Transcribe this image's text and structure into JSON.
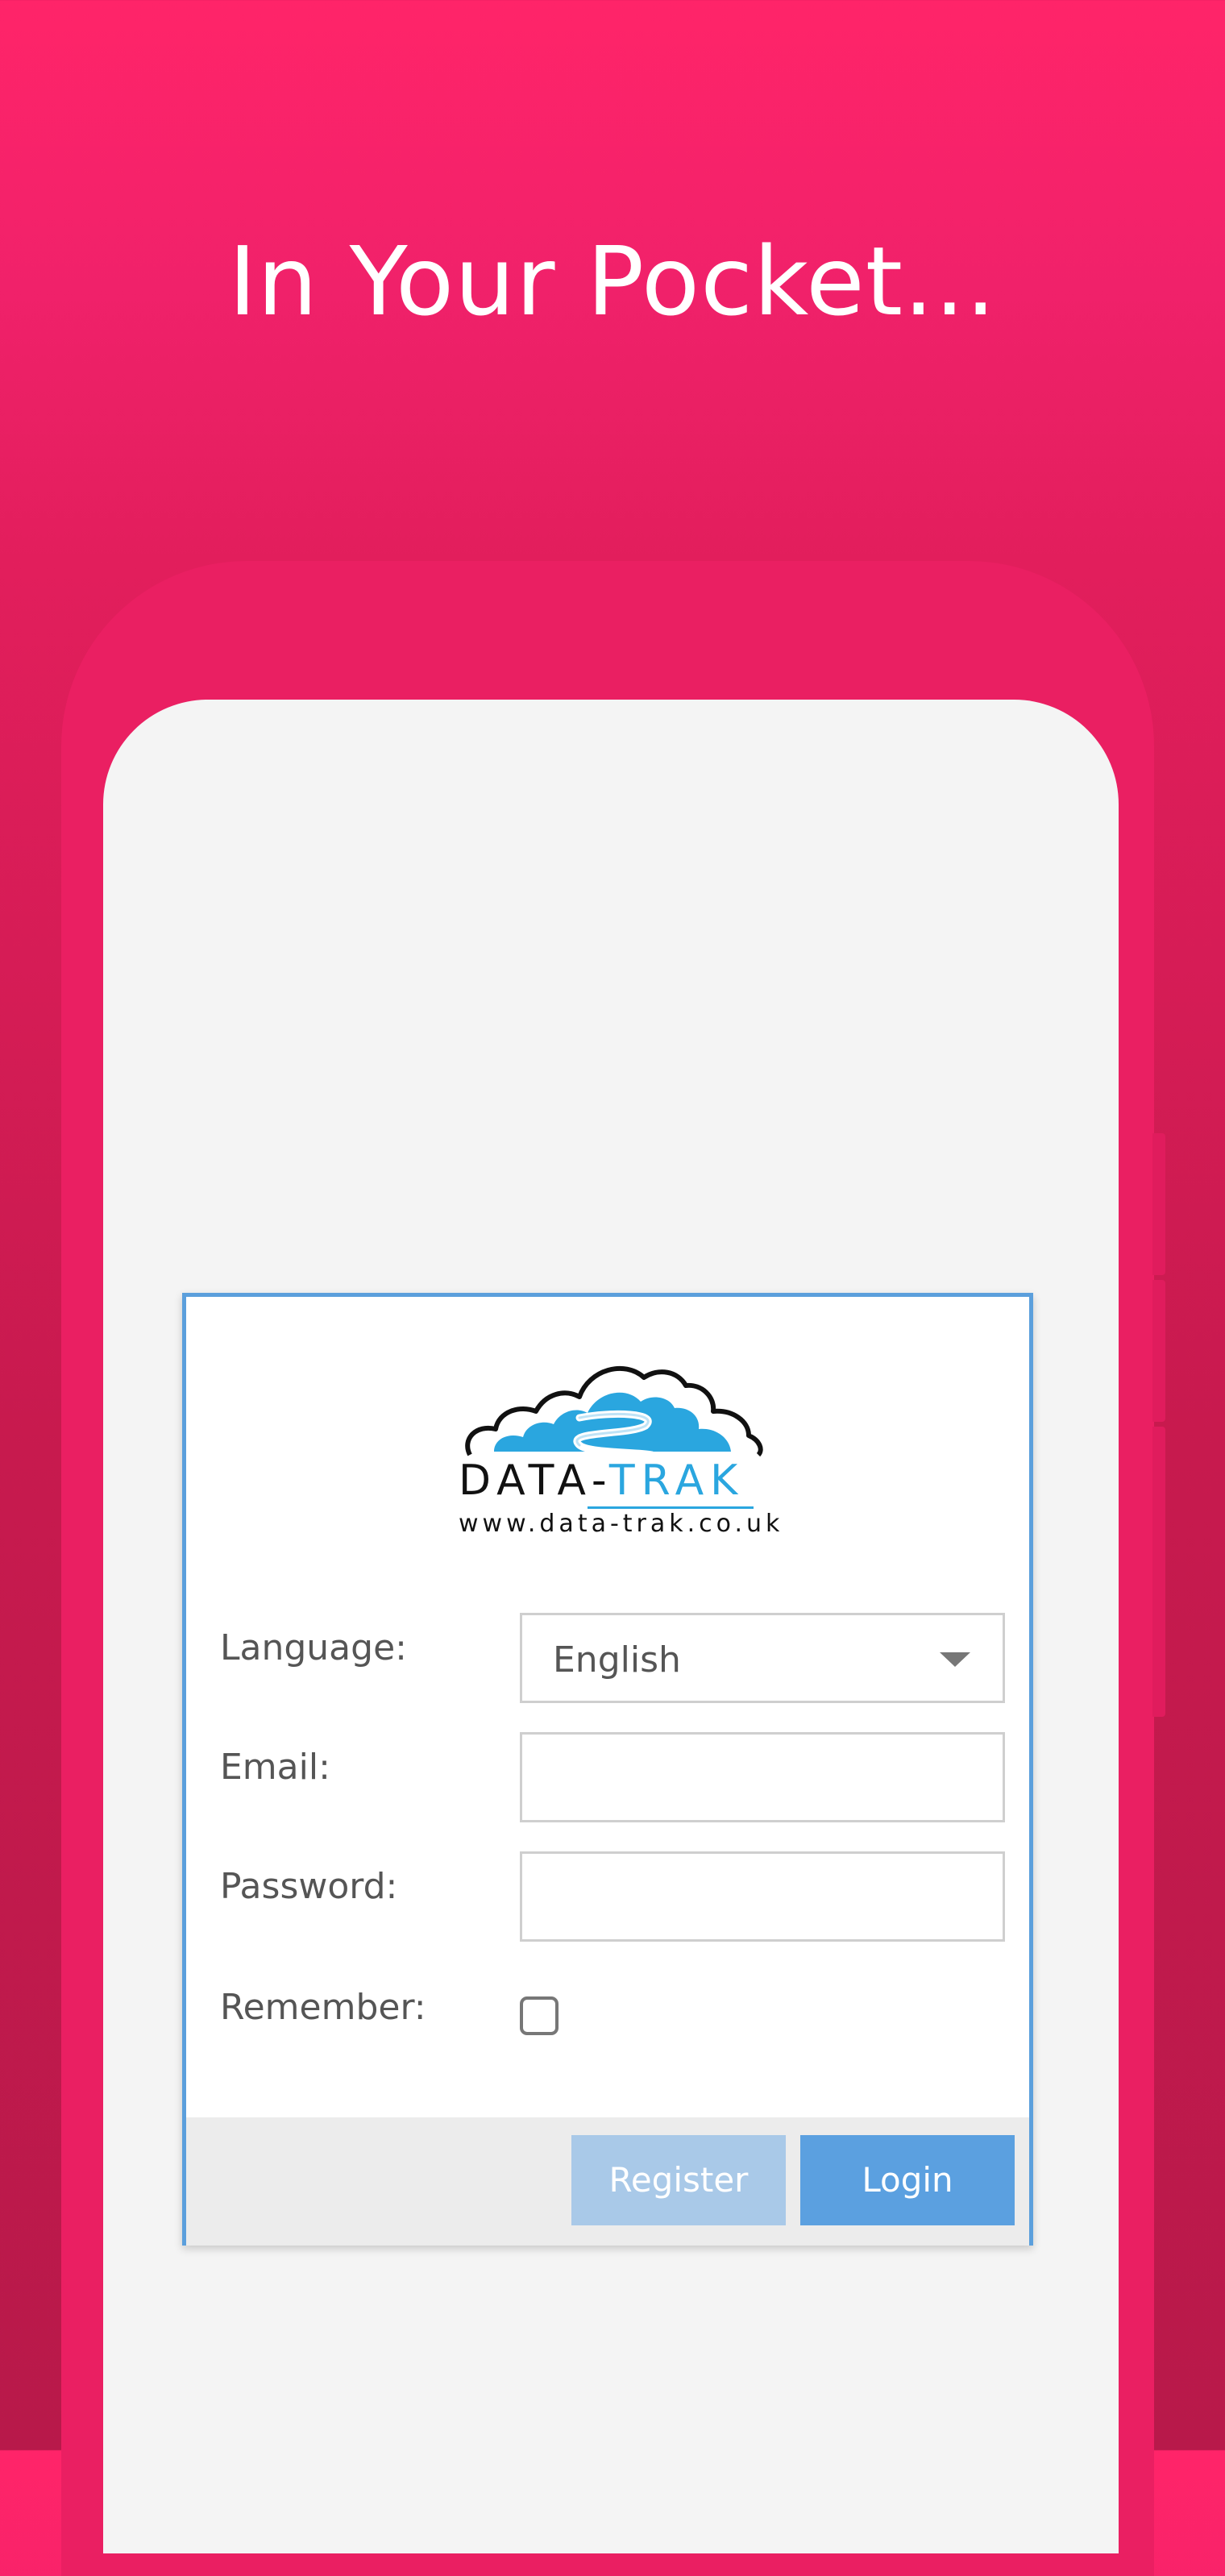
{
  "headline": "In Your Pocket...",
  "logo": {
    "brand_data": "DATA-",
    "brand_trak": "TRAK",
    "url": "www.data-trak.co.uk"
  },
  "form": {
    "language": {
      "label": "Language:",
      "value": "English"
    },
    "email": {
      "label": "Email:",
      "value": ""
    },
    "password": {
      "label": "Password:",
      "value": ""
    },
    "remember": {
      "label": "Remember:",
      "checked": false
    }
  },
  "buttons": {
    "register": "Register",
    "login": "Login"
  },
  "colors": {
    "background": "#ff2469",
    "panel_border": "#5b9fdc",
    "login_button": "#5ba0e0",
    "register_button": "#a9c9e8",
    "brand_blue": "#2aa6df"
  },
  "icons": {
    "language_dropdown": "chevron-down-icon",
    "logo": "cloud-river-logo"
  }
}
